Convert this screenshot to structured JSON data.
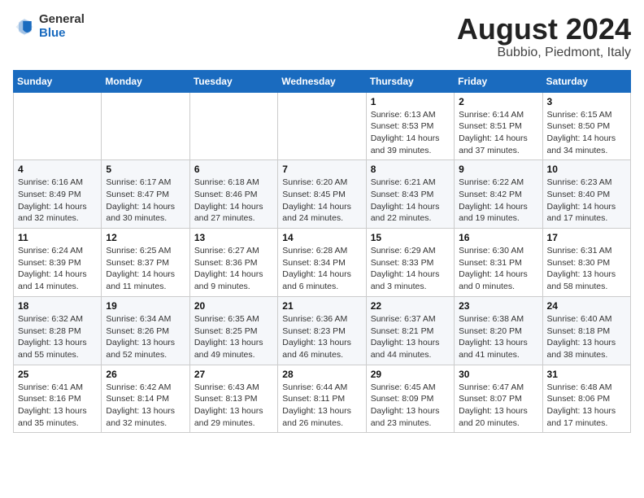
{
  "header": {
    "logo_general": "General",
    "logo_blue": "Blue",
    "month_year": "August 2024",
    "location": "Bubbio, Piedmont, Italy"
  },
  "weekdays": [
    "Sunday",
    "Monday",
    "Tuesday",
    "Wednesday",
    "Thursday",
    "Friday",
    "Saturday"
  ],
  "weeks": [
    [
      {
        "day": "",
        "info": ""
      },
      {
        "day": "",
        "info": ""
      },
      {
        "day": "",
        "info": ""
      },
      {
        "day": "",
        "info": ""
      },
      {
        "day": "1",
        "info": "Sunrise: 6:13 AM\nSunset: 8:53 PM\nDaylight: 14 hours and 39 minutes."
      },
      {
        "day": "2",
        "info": "Sunrise: 6:14 AM\nSunset: 8:51 PM\nDaylight: 14 hours and 37 minutes."
      },
      {
        "day": "3",
        "info": "Sunrise: 6:15 AM\nSunset: 8:50 PM\nDaylight: 14 hours and 34 minutes."
      }
    ],
    [
      {
        "day": "4",
        "info": "Sunrise: 6:16 AM\nSunset: 8:49 PM\nDaylight: 14 hours and 32 minutes."
      },
      {
        "day": "5",
        "info": "Sunrise: 6:17 AM\nSunset: 8:47 PM\nDaylight: 14 hours and 30 minutes."
      },
      {
        "day": "6",
        "info": "Sunrise: 6:18 AM\nSunset: 8:46 PM\nDaylight: 14 hours and 27 minutes."
      },
      {
        "day": "7",
        "info": "Sunrise: 6:20 AM\nSunset: 8:45 PM\nDaylight: 14 hours and 24 minutes."
      },
      {
        "day": "8",
        "info": "Sunrise: 6:21 AM\nSunset: 8:43 PM\nDaylight: 14 hours and 22 minutes."
      },
      {
        "day": "9",
        "info": "Sunrise: 6:22 AM\nSunset: 8:42 PM\nDaylight: 14 hours and 19 minutes."
      },
      {
        "day": "10",
        "info": "Sunrise: 6:23 AM\nSunset: 8:40 PM\nDaylight: 14 hours and 17 minutes."
      }
    ],
    [
      {
        "day": "11",
        "info": "Sunrise: 6:24 AM\nSunset: 8:39 PM\nDaylight: 14 hours and 14 minutes."
      },
      {
        "day": "12",
        "info": "Sunrise: 6:25 AM\nSunset: 8:37 PM\nDaylight: 14 hours and 11 minutes."
      },
      {
        "day": "13",
        "info": "Sunrise: 6:27 AM\nSunset: 8:36 PM\nDaylight: 14 hours and 9 minutes."
      },
      {
        "day": "14",
        "info": "Sunrise: 6:28 AM\nSunset: 8:34 PM\nDaylight: 14 hours and 6 minutes."
      },
      {
        "day": "15",
        "info": "Sunrise: 6:29 AM\nSunset: 8:33 PM\nDaylight: 14 hours and 3 minutes."
      },
      {
        "day": "16",
        "info": "Sunrise: 6:30 AM\nSunset: 8:31 PM\nDaylight: 14 hours and 0 minutes."
      },
      {
        "day": "17",
        "info": "Sunrise: 6:31 AM\nSunset: 8:30 PM\nDaylight: 13 hours and 58 minutes."
      }
    ],
    [
      {
        "day": "18",
        "info": "Sunrise: 6:32 AM\nSunset: 8:28 PM\nDaylight: 13 hours and 55 minutes."
      },
      {
        "day": "19",
        "info": "Sunrise: 6:34 AM\nSunset: 8:26 PM\nDaylight: 13 hours and 52 minutes."
      },
      {
        "day": "20",
        "info": "Sunrise: 6:35 AM\nSunset: 8:25 PM\nDaylight: 13 hours and 49 minutes."
      },
      {
        "day": "21",
        "info": "Sunrise: 6:36 AM\nSunset: 8:23 PM\nDaylight: 13 hours and 46 minutes."
      },
      {
        "day": "22",
        "info": "Sunrise: 6:37 AM\nSunset: 8:21 PM\nDaylight: 13 hours and 44 minutes."
      },
      {
        "day": "23",
        "info": "Sunrise: 6:38 AM\nSunset: 8:20 PM\nDaylight: 13 hours and 41 minutes."
      },
      {
        "day": "24",
        "info": "Sunrise: 6:40 AM\nSunset: 8:18 PM\nDaylight: 13 hours and 38 minutes."
      }
    ],
    [
      {
        "day": "25",
        "info": "Sunrise: 6:41 AM\nSunset: 8:16 PM\nDaylight: 13 hours and 35 minutes."
      },
      {
        "day": "26",
        "info": "Sunrise: 6:42 AM\nSunset: 8:14 PM\nDaylight: 13 hours and 32 minutes."
      },
      {
        "day": "27",
        "info": "Sunrise: 6:43 AM\nSunset: 8:13 PM\nDaylight: 13 hours and 29 minutes."
      },
      {
        "day": "28",
        "info": "Sunrise: 6:44 AM\nSunset: 8:11 PM\nDaylight: 13 hours and 26 minutes."
      },
      {
        "day": "29",
        "info": "Sunrise: 6:45 AM\nSunset: 8:09 PM\nDaylight: 13 hours and 23 minutes."
      },
      {
        "day": "30",
        "info": "Sunrise: 6:47 AM\nSunset: 8:07 PM\nDaylight: 13 hours and 20 minutes."
      },
      {
        "day": "31",
        "info": "Sunrise: 6:48 AM\nSunset: 8:06 PM\nDaylight: 13 hours and 17 minutes."
      }
    ]
  ]
}
